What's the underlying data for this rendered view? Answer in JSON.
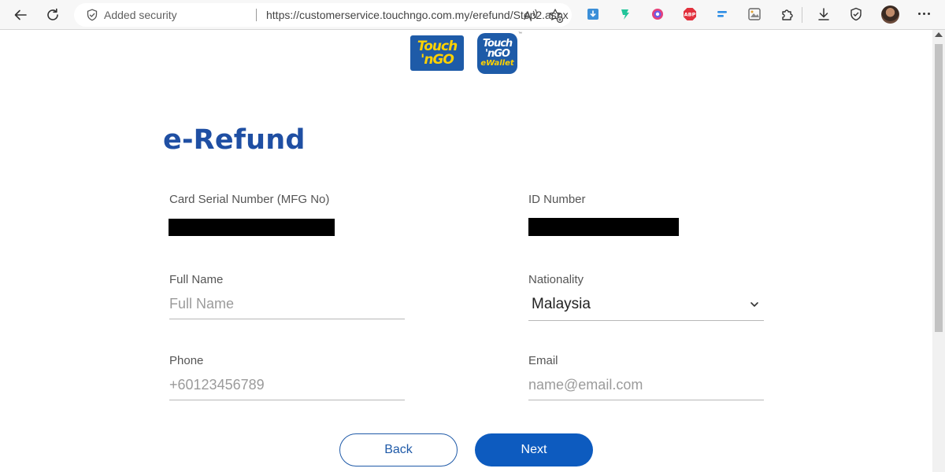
{
  "browser": {
    "security_label": "Added security",
    "url": "https://customerservice.touchngo.com.my/erefund/Step2.aspx",
    "icons": [
      "back-arrow-icon",
      "refresh-icon",
      "shield-icon",
      "read-aloud-icon",
      "favorite-star-icon",
      "download-extension-icon",
      "green-extension-icon",
      "color-picker-extension-icon",
      "adblock-icon",
      "blue-extension-icon",
      "screenshot-extension-icon",
      "extensions-puzzle-icon",
      "downloads-icon",
      "browser-essentials-icon",
      "profile-avatar",
      "more-menu-icon"
    ]
  },
  "logos": {
    "tng_line1": "Touch",
    "tng_line2": "'nGO",
    "ewallet_line1": "Touch",
    "ewallet_line2": "'nGO",
    "ewallet_line3": "eWallet",
    "trademark": "™"
  },
  "page": {
    "title": "e-Refund"
  },
  "form": {
    "card_serial_label": "Card Serial Number (MFG No)",
    "id_number_label": "ID Number",
    "full_name_label": "Full Name",
    "full_name_placeholder": "Full Name",
    "nationality_label": "Nationality",
    "nationality_value": "Malaysia",
    "phone_label": "Phone",
    "phone_placeholder": "+60123456789",
    "email_label": "Email",
    "email_placeholder": "name@email.com"
  },
  "buttons": {
    "back_label": "Back",
    "next_label": "Next"
  },
  "colors": {
    "brand_blue": "#1f4fa3",
    "button_blue": "#0d5bbf",
    "logo_yellow": "#ffd200"
  }
}
